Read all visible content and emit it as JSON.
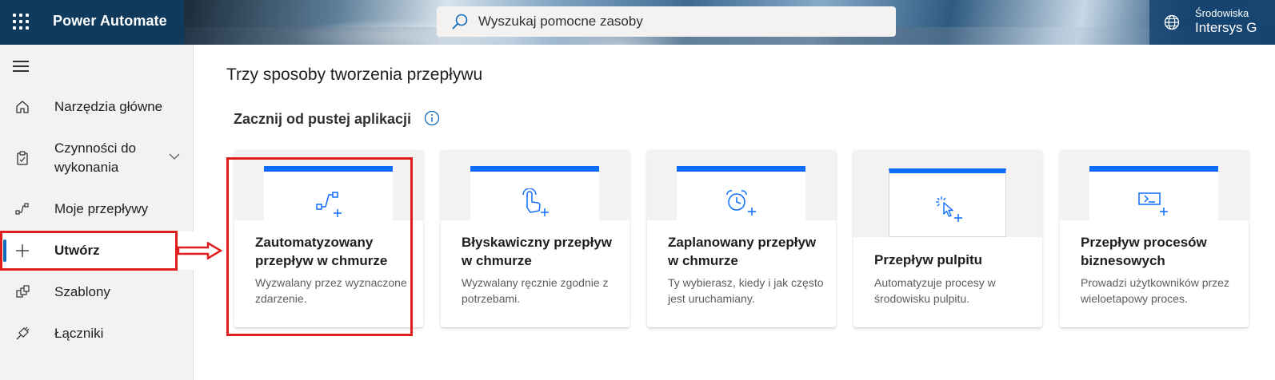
{
  "header": {
    "app_name": "Power Automate",
    "search_placeholder": "Wyszukaj pomocne zasoby",
    "environment_label": "Środowiska",
    "environment_name": "Intersys G",
    "accent_color": "#0f3a5c"
  },
  "sidebar": {
    "items": [
      {
        "label": "Narzędzia główne",
        "icon": "home-icon"
      },
      {
        "label": "Czynności do wykonania",
        "icon": "clipboard-icon",
        "expandable": true
      },
      {
        "label": "Moje przepływy",
        "icon": "flow-icon"
      },
      {
        "label": "Utwórz",
        "icon": "plus-icon",
        "active": true
      },
      {
        "label": "Szablony",
        "icon": "templates-icon"
      },
      {
        "label": "Łączniki",
        "icon": "connector-icon"
      }
    ]
  },
  "main": {
    "title": "Trzy sposoby tworzenia przepływu",
    "section_title": "Zacznij od pustej aplikacji",
    "cards": [
      {
        "title": "Zautomatyzowany przepływ w chmurze",
        "description": "Wyzwalany przez wyznaczone zdarzenie.",
        "icon": "automated-flow-icon",
        "highlighted": true
      },
      {
        "title": "Błyskawiczny przepływ w chmurze",
        "description": "Wyzwalany ręcznie zgodnie z potrzebami.",
        "icon": "touch-icon"
      },
      {
        "title": "Zaplanowany przepływ w chmurze",
        "description": "Ty wybierasz, kiedy i jak często jest uruchamiany.",
        "icon": "alarm-clock-icon"
      },
      {
        "title": "Przepływ pulpitu",
        "description": "Automatyzuje procesy w środowisku pulpitu.",
        "icon": "cursor-click-icon"
      },
      {
        "title": "Przepływ procesów biznesowych",
        "description": "Prowadzi użytkowników przez wieloetapowy proces.",
        "icon": "process-icon"
      }
    ]
  },
  "colors": {
    "primary_blue": "#0f6cfd",
    "annotation_red": "#e01e1e",
    "sidebar_bg": "#f3f2f1"
  }
}
